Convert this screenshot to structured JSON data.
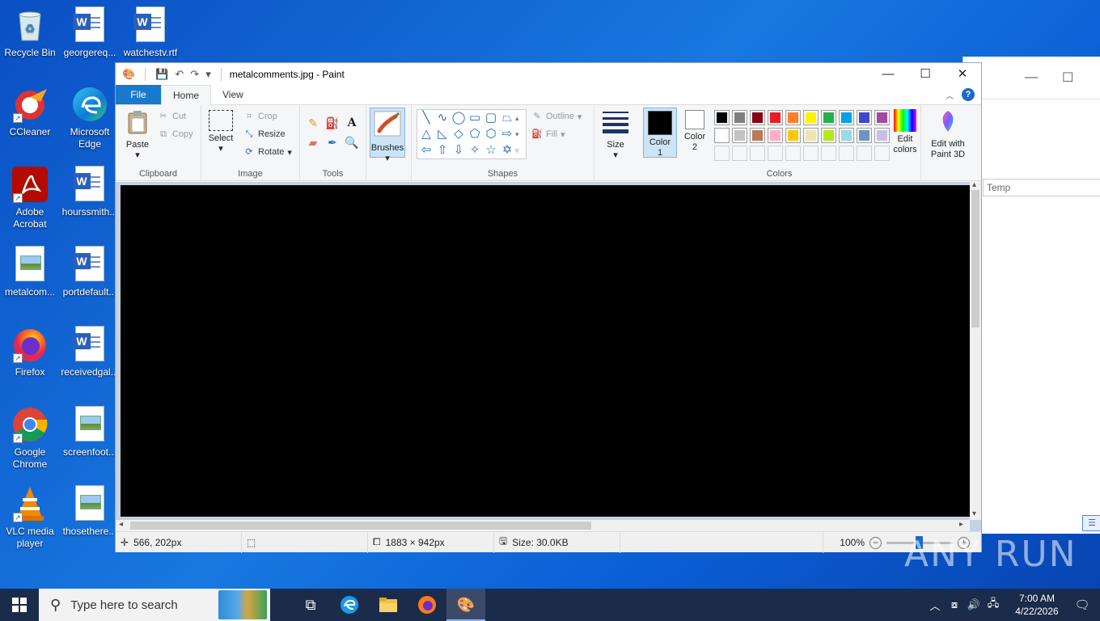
{
  "desktop": {
    "icons_col1": [
      {
        "label": "Recycle Bin",
        "icon": "recycle-bin-icon"
      },
      {
        "label": "CCleaner",
        "icon": "ccleaner-icon"
      },
      {
        "label": "Adobe Acrobat",
        "icon": "acrobat-icon"
      },
      {
        "label": "metalcom...",
        "icon": "image-file-icon"
      },
      {
        "label": "Firefox",
        "icon": "firefox-icon"
      },
      {
        "label": "Google Chrome",
        "icon": "chrome-icon"
      },
      {
        "label": "VLC media player",
        "icon": "vlc-icon"
      }
    ],
    "icons_col2": [
      {
        "label": "georgereq...",
        "icon": "word-doc-icon"
      },
      {
        "label": "Microsoft Edge",
        "icon": "edge-icon"
      },
      {
        "label": "hourssmith...",
        "icon": "word-doc-icon"
      },
      {
        "label": "portdefault...",
        "icon": "word-doc-icon"
      },
      {
        "label": "receivedgal...",
        "icon": "word-doc-icon"
      },
      {
        "label": "screenfoot...",
        "icon": "image-file-icon"
      },
      {
        "label": "thosethere...",
        "icon": "image-file-icon"
      }
    ],
    "icons_col3": [
      {
        "label": "watchestv.rtf",
        "icon": "word-doc-icon"
      }
    ]
  },
  "background_window": {
    "search_placeholder": "Temp"
  },
  "paint": {
    "title": "metalcomments.jpg - Paint",
    "tabs": [
      "File",
      "Home",
      "View"
    ],
    "clipboard": {
      "paste": "Paste",
      "cut": "Cut",
      "copy": "Copy",
      "label": "Clipboard"
    },
    "image": {
      "select": "Select",
      "crop": "Crop",
      "resize": "Resize",
      "rotate": "Rotate",
      "label": "Image"
    },
    "tools": {
      "label": "Tools"
    },
    "brushes": {
      "label": "Brushes"
    },
    "shapes": {
      "outline": "Outline",
      "fill": "Fill",
      "label": "Shapes"
    },
    "size": {
      "label": "Size"
    },
    "colors": {
      "color1": "Color 1",
      "color2": "Color 2",
      "edit": "Edit colors",
      "label": "Colors",
      "row1": [
        "#000000",
        "#7f7f7f",
        "#880015",
        "#ed1c24",
        "#ff7f27",
        "#fff200",
        "#22b14c",
        "#00a2e8",
        "#3f48cc",
        "#a349a4"
      ],
      "row2": [
        "#ffffff",
        "#c3c3c3",
        "#b97a57",
        "#ffaec9",
        "#ffc90e",
        "#efe4b0",
        "#b5e61d",
        "#99d9ea",
        "#7092be",
        "#c8bfe7"
      ]
    },
    "paint3d": "Edit with Paint 3D",
    "status": {
      "cursor": "566, 202px",
      "dimensions": "1883 × 942px",
      "size": "Size: 30.0KB",
      "zoom": "100%"
    }
  },
  "taskbar": {
    "search_placeholder": "Type here to search",
    "time": "7:00 AM",
    "date": "4/22/2026"
  },
  "watermark": "ANY RUN"
}
